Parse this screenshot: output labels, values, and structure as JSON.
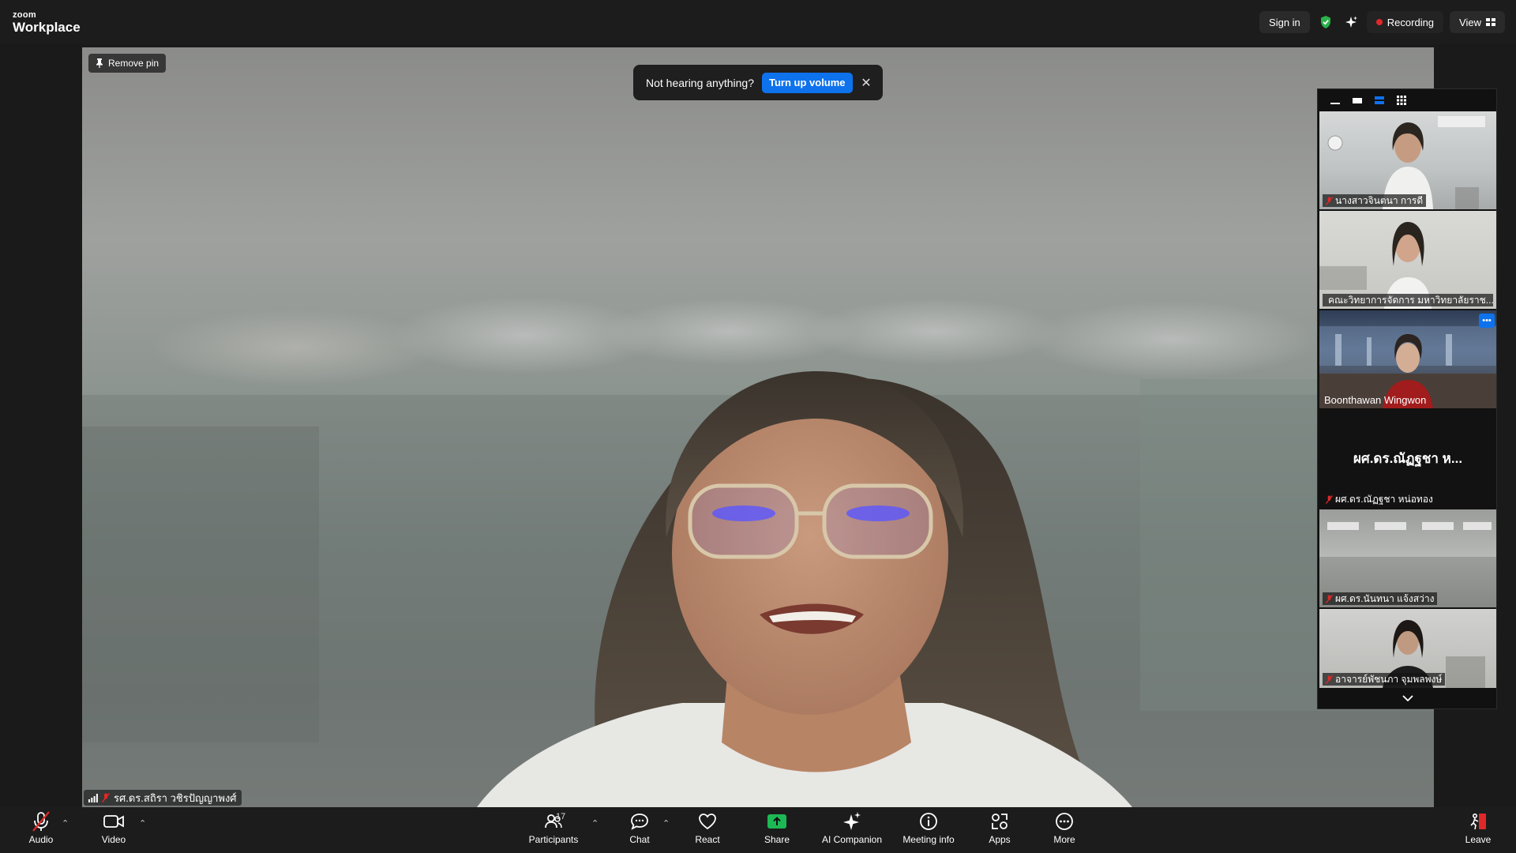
{
  "app": {
    "brand_small": "zoom",
    "brand_large": "Workplace"
  },
  "topbar": {
    "sign_in": "Sign in",
    "recording": "Recording",
    "view": "View"
  },
  "stage": {
    "remove_pin": "Remove pin",
    "toast_text": "Not hearing anything?",
    "toast_button": "Turn up volume",
    "speaker_name": "รศ.ดร.สถิรา วชิรปัญญาพงศ์"
  },
  "gallery": {
    "tiles": [
      {
        "name": "นางสาวจินตนา การดี"
      },
      {
        "name": "คณะวิทยาการจัดการ มหาวิทยาลัยราช..."
      },
      {
        "name": "Boonthawan Wingwon"
      },
      {
        "name": "ผศ.ดร.ณัฏฐชา หน่อทอง",
        "display": "ผศ.ดร.ณัฏฐชา ห..."
      },
      {
        "name": "ผศ.ดร.นันทนา แจ้งสว่าง"
      },
      {
        "name": "อาจารย์พัชนภา จุมพลพงษ์"
      }
    ]
  },
  "toolbar": {
    "audio": "Audio",
    "video": "Video",
    "participants": "Participants",
    "participants_count": "17",
    "chat": "Chat",
    "react": "React",
    "share": "Share",
    "ai_companion": "AI Companion",
    "meeting_info": "Meeting info",
    "apps": "Apps",
    "more": "More",
    "leave": "Leave"
  },
  "colors": {
    "accent": "#0e72ed",
    "share": "#1db954",
    "recording": "#e02828",
    "leave": "#e02828"
  }
}
